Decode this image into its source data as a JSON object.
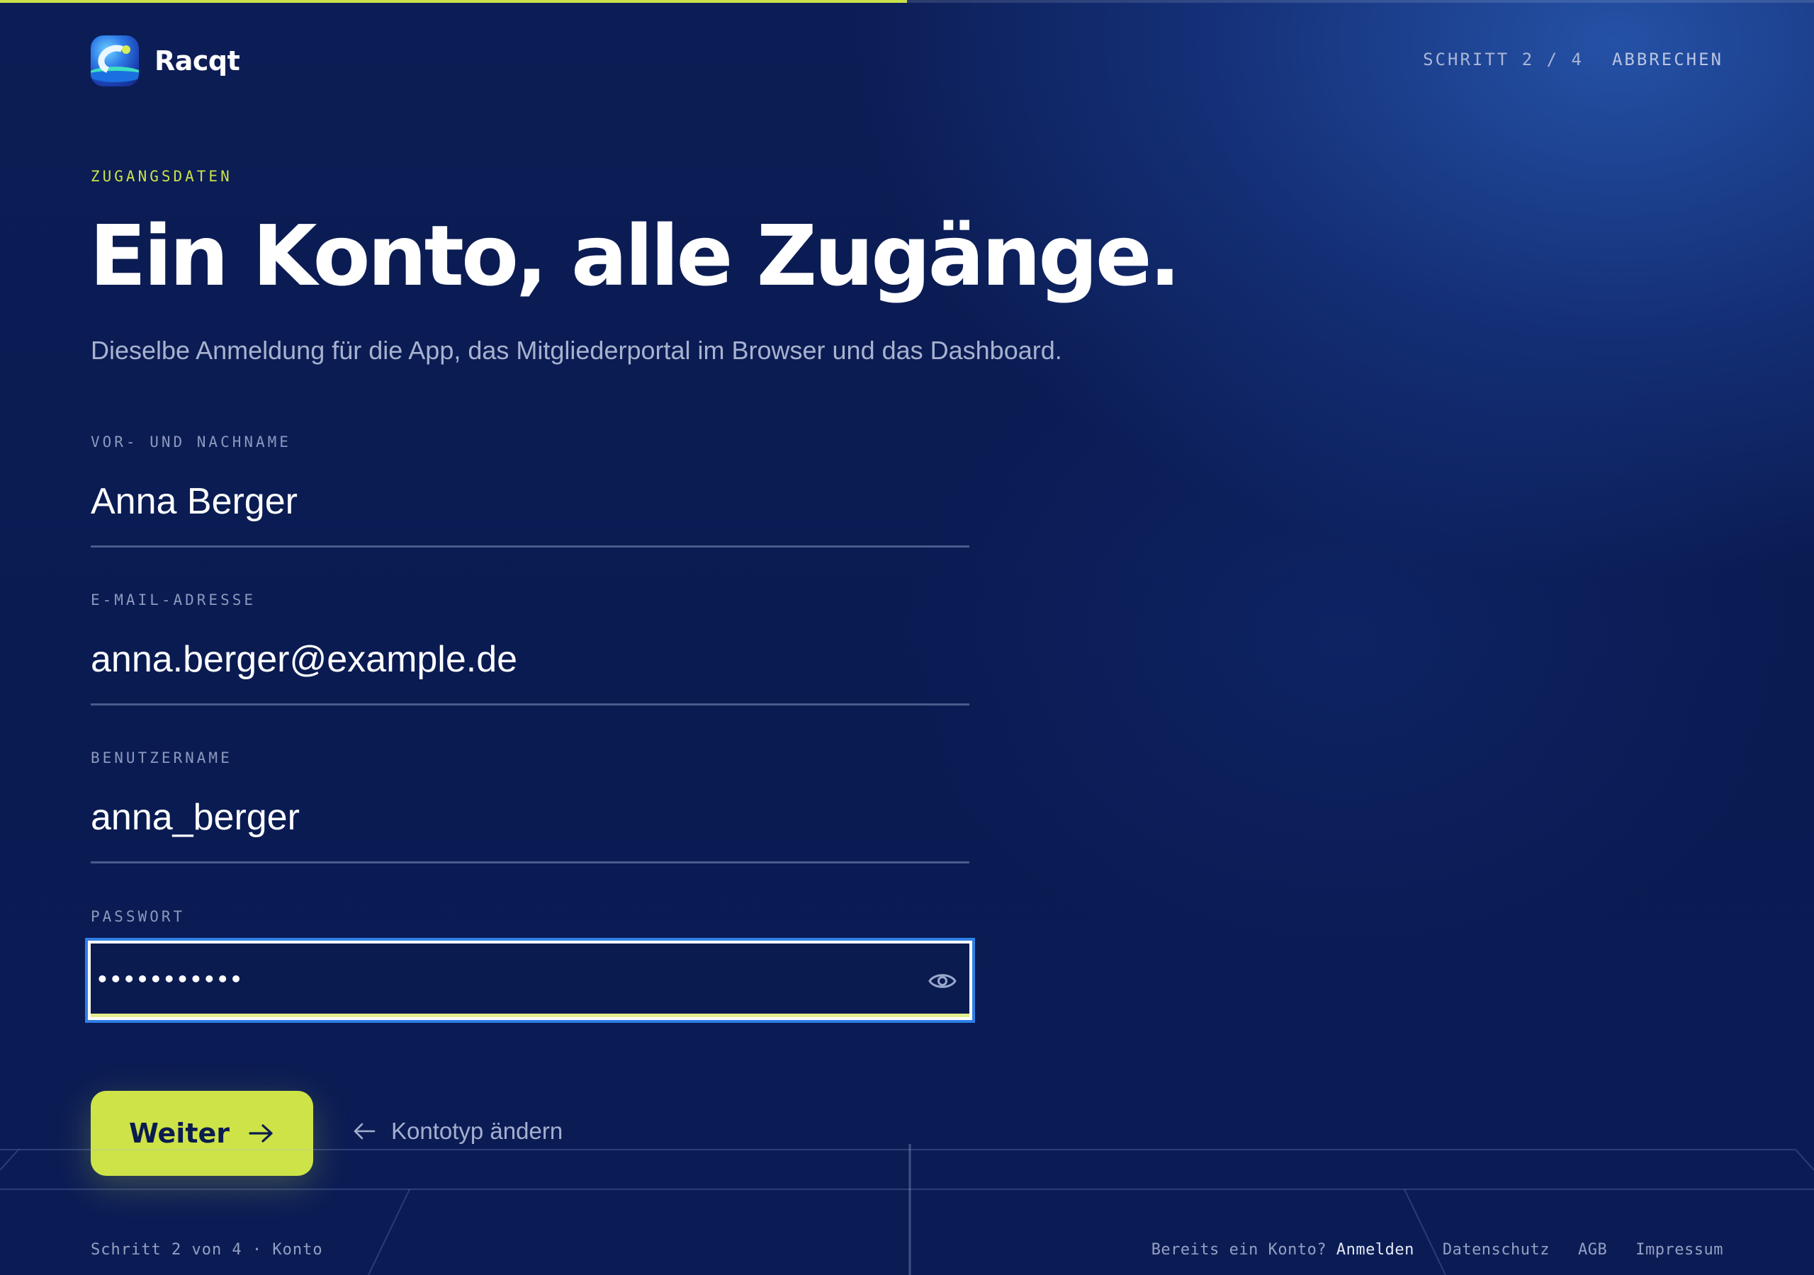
{
  "brand": {
    "name": "Racqt"
  },
  "header": {
    "step": "SCHRITT 2 / 4",
    "cancel": "ABBRECHEN"
  },
  "progress": {
    "current_step": 2,
    "total_steps": 4,
    "fraction": 0.5
  },
  "intro": {
    "eyebrow": "ZUGANGSDATEN",
    "title": "Ein Konto, alle Zugänge.",
    "subtitle": "Dieselbe Anmeldung für die App, das Mitgliederportal im Browser und das Dashboard."
  },
  "form": {
    "name": {
      "label": "VOR- UND NACHNAME",
      "value": "Anna Berger"
    },
    "email": {
      "label": "E-MAIL-ADRESSE",
      "value": "anna.berger@example.de"
    },
    "username": {
      "label": "BENUTZERNAME",
      "value": "anna_berger"
    },
    "password": {
      "label": "PASSWORT",
      "masked_value": "•••••••••••",
      "reveal_icon": "eye-icon"
    }
  },
  "actions": {
    "next": "Weiter",
    "back": "Kontotyp ändern"
  },
  "footer": {
    "status": "Schritt 2 von 4 · Konto",
    "have_account": "Bereits ein Konto?",
    "login": "Anmelden",
    "links": [
      "Datenschutz",
      "AGB",
      "Impressum"
    ]
  },
  "colors": {
    "accent": "#cde347",
    "background": "#0b1d52",
    "focus": "#2f80e6"
  }
}
